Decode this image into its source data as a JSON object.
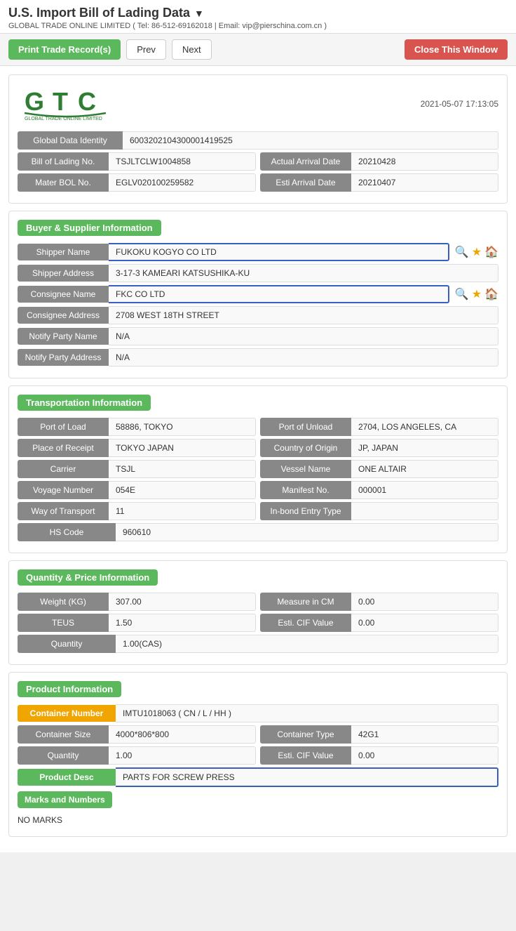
{
  "header": {
    "title": "U.S. Import Bill of Lading Data",
    "subtitle": "GLOBAL TRADE ONLINE LIMITED ( Tel: 86-512-69162018 | Email: vip@pierschina.com.cn )"
  },
  "toolbar": {
    "print_label": "Print Trade Record(s)",
    "prev_label": "Prev",
    "next_label": "Next",
    "close_label": "Close This Window"
  },
  "record": {
    "timestamp": "2021-05-07 17:13:05",
    "global_data_identity_label": "Global Data Identity",
    "global_data_identity_value": "6003202104300001419525",
    "bill_of_lading_no_label": "Bill of Lading No.",
    "bill_of_lading_no_value": "TSJLTCLW1004858",
    "actual_arrival_date_label": "Actual Arrival Date",
    "actual_arrival_date_value": "20210428",
    "mater_bol_no_label": "Mater BOL No.",
    "mater_bol_no_value": "EGLV020100259582",
    "esti_arrival_date_label": "Esti Arrival Date",
    "esti_arrival_date_value": "20210407"
  },
  "buyer_supplier": {
    "section_title": "Buyer & Supplier Information",
    "shipper_name_label": "Shipper Name",
    "shipper_name_value": "FUKOKU KOGYO CO LTD",
    "shipper_address_label": "Shipper Address",
    "shipper_address_value": "3-17-3 KAMEARI KATSUSHIKA-KU",
    "consignee_name_label": "Consignee Name",
    "consignee_name_value": "FKC CO LTD",
    "consignee_address_label": "Consignee Address",
    "consignee_address_value": "2708 WEST 18TH STREET",
    "notify_party_name_label": "Notify Party Name",
    "notify_party_name_value": "N/A",
    "notify_party_address_label": "Notify Party Address",
    "notify_party_address_value": "N/A"
  },
  "transportation": {
    "section_title": "Transportation Information",
    "port_of_load_label": "Port of Load",
    "port_of_load_value": "58886, TOKYO",
    "port_of_unload_label": "Port of Unload",
    "port_of_unload_value": "2704, LOS ANGELES, CA",
    "place_of_receipt_label": "Place of Receipt",
    "place_of_receipt_value": "TOKYO JAPAN",
    "country_of_origin_label": "Country of Origin",
    "country_of_origin_value": "JP, JAPAN",
    "carrier_label": "Carrier",
    "carrier_value": "TSJL",
    "vessel_name_label": "Vessel Name",
    "vessel_name_value": "ONE ALTAIR",
    "voyage_number_label": "Voyage Number",
    "voyage_number_value": "054E",
    "manifest_no_label": "Manifest No.",
    "manifest_no_value": "000001",
    "way_of_transport_label": "Way of Transport",
    "way_of_transport_value": "11",
    "in_bond_entry_type_label": "In-bond Entry Type",
    "in_bond_entry_type_value": "",
    "hs_code_label": "HS Code",
    "hs_code_value": "960610"
  },
  "quantity_price": {
    "section_title": "Quantity & Price Information",
    "weight_kg_label": "Weight (KG)",
    "weight_kg_value": "307.00",
    "measure_in_cm_label": "Measure in CM",
    "measure_in_cm_value": "0.00",
    "teus_label": "TEUS",
    "teus_value": "1.50",
    "esti_cif_value_label": "Esti. CIF Value",
    "esti_cif_value_value": "0.00",
    "quantity_label": "Quantity",
    "quantity_value": "1.00(CAS)"
  },
  "product_information": {
    "section_title": "Product Information",
    "container_number_label": "Container Number",
    "container_number_value": "IMTU1018063 ( CN / L / HH )",
    "container_size_label": "Container Size",
    "container_size_value": "4000*806*800",
    "container_type_label": "Container Type",
    "container_type_value": "42G1",
    "quantity_label": "Quantity",
    "quantity_value": "1.00",
    "esti_cif_value_label": "Esti. CIF Value",
    "esti_cif_value_value": "0.00",
    "product_desc_label": "Product Desc",
    "product_desc_value": "PARTS FOR SCREW PRESS",
    "marks_and_numbers_label": "Marks and Numbers",
    "marks_and_numbers_value": "NO MARKS"
  }
}
